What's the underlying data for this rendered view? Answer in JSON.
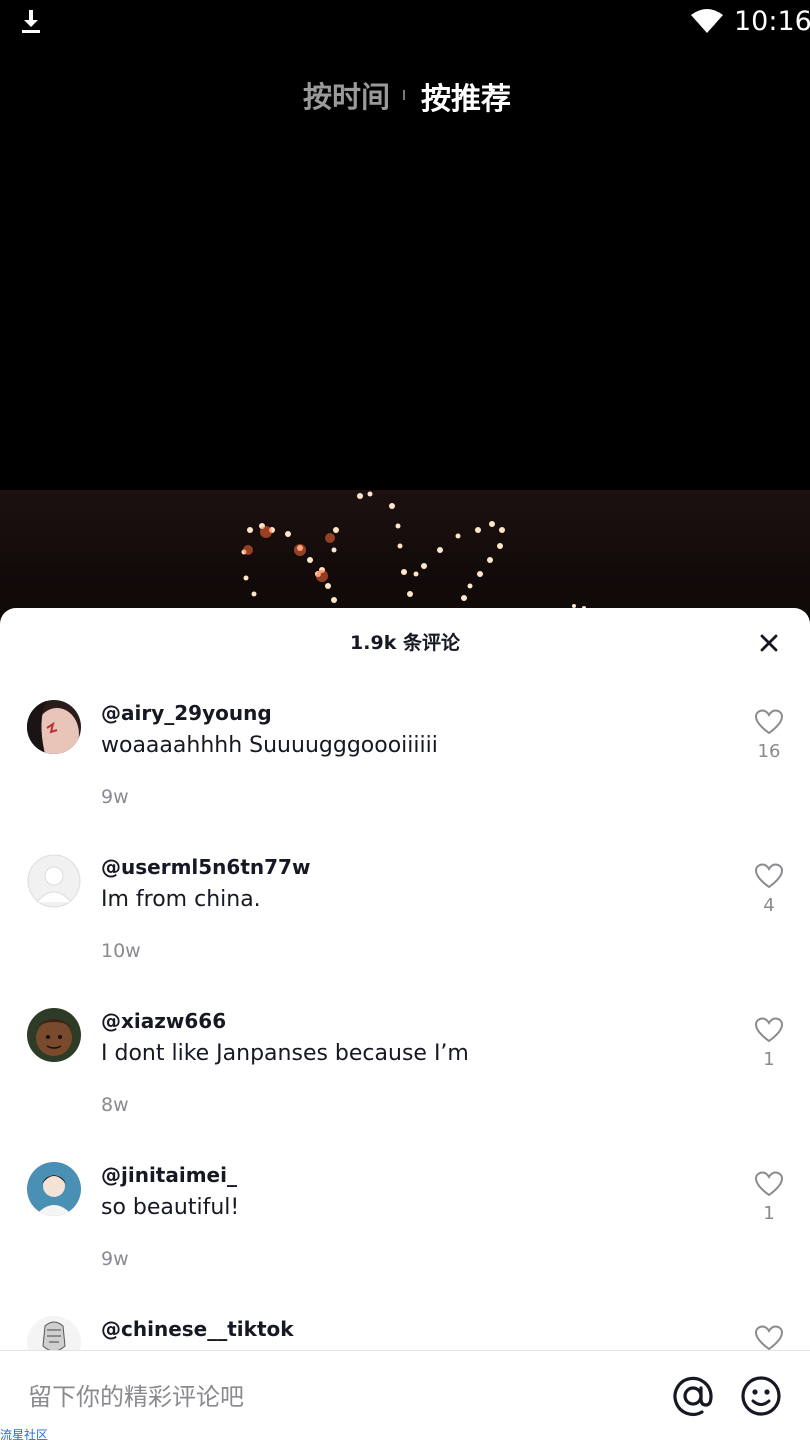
{
  "status_bar": {
    "time": "10:16",
    "icons": [
      "download-icon",
      "wifi-icon"
    ]
  },
  "top_tabs": {
    "by_time": "按时间",
    "by_recommend": "按推荐",
    "active": "按推荐"
  },
  "sheet": {
    "title": "1.9k 条评论",
    "close_icon": "close-icon"
  },
  "comments": [
    {
      "username": "@airy_29young",
      "text": "woaaaahhhh Suuuugggoooiiiiii",
      "time": "9w",
      "likes": "16"
    },
    {
      "username": "@userml5n6tn77w",
      "text": "Im from china.",
      "time": "10w",
      "likes": "4"
    },
    {
      "username": "@xiazw666",
      "text": "I dont like Janpanses because I’m",
      "time": "8w",
      "likes": "1"
    },
    {
      "username": "@jinitaimei_",
      "text": "so beautiful!",
      "time": "9w",
      "likes": "1"
    },
    {
      "username": "@chinese__tiktok",
      "text": "",
      "time": "",
      "likes": ""
    }
  ],
  "input": {
    "placeholder": "留下你的精彩评论吧"
  },
  "watermark": "流星社区",
  "colors": {
    "sheet_bg": "#ffffff",
    "text_primary": "#161823",
    "text_secondary": "#8a8b91",
    "background": "#000000"
  }
}
